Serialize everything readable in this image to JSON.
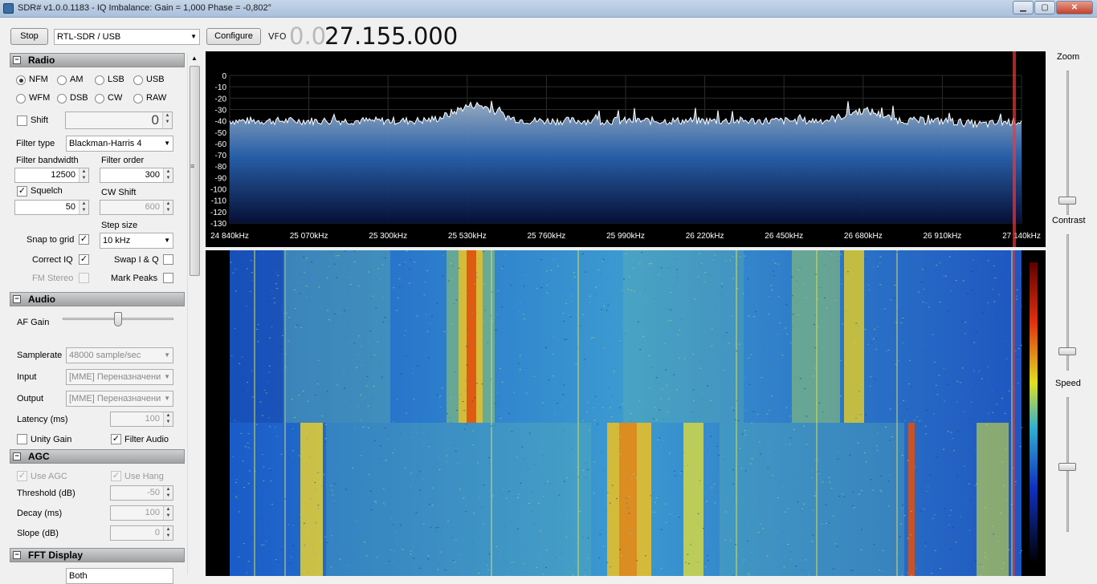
{
  "window": {
    "title": "SDR# v1.0.0.1183 - IQ Imbalance: Gain = 1,000 Phase = -0,802°",
    "min": "▁",
    "max": "▢",
    "close": "✕"
  },
  "toolbar": {
    "stop_label": "Stop",
    "device": "RTL-SDR / USB",
    "configure_label": "Configure",
    "vfo_label": "VFO",
    "vfo_dim": "0.0",
    "vfo_main": "27.155.000"
  },
  "radio": {
    "header": "Radio",
    "modes": [
      {
        "label": "NFM",
        "selected": true
      },
      {
        "label": "AM",
        "selected": false
      },
      {
        "label": "LSB",
        "selected": false
      },
      {
        "label": "USB",
        "selected": false
      },
      {
        "label": "WFM",
        "selected": false
      },
      {
        "label": "DSB",
        "selected": false
      },
      {
        "label": "CW",
        "selected": false
      },
      {
        "label": "RAW",
        "selected": false
      }
    ],
    "shift_label": "Shift",
    "shift_value": "0",
    "filter_type_label": "Filter type",
    "filter_type_value": "Blackman-Harris 4",
    "filter_bandwidth_label": "Filter bandwidth",
    "filter_bandwidth_value": "12500",
    "filter_order_label": "Filter order",
    "filter_order_value": "300",
    "squelch_label": "Squelch",
    "squelch_value": "50",
    "cw_shift_label": "CW Shift",
    "cw_shift_value": "600",
    "step_size_label": "Step size",
    "step_size_value": "10 kHz",
    "snap_label": "Snap to grid",
    "correct_iq_label": "Correct IQ",
    "swap_iq_label": "Swap I & Q",
    "fm_stereo_label": "FM Stereo",
    "mark_peaks_label": "Mark Peaks"
  },
  "audio": {
    "header": "Audio",
    "af_gain_label": "AF Gain",
    "af_gain_level": 0.5,
    "samplerate_label": "Samplerate",
    "samplerate_value": "48000 sample/sec",
    "input_label": "Input",
    "input_value": "[MME] Переназначени",
    "output_label": "Output",
    "output_value": "[MME] Переназначени",
    "latency_label": "Latency (ms)",
    "latency_value": "100",
    "unity_gain_label": "Unity Gain",
    "filter_audio_label": "Filter Audio"
  },
  "agc": {
    "header": "AGC",
    "use_agc_label": "Use AGC",
    "use_hang_label": "Use Hang",
    "threshold_label": "Threshold (dB)",
    "threshold_value": "-50",
    "decay_label": "Decay (ms)",
    "decay_value": "100",
    "slope_label": "Slope (dB)",
    "slope_value": "0"
  },
  "fft": {
    "header": "FFT Display",
    "view_value": "Both"
  },
  "right_panel": {
    "zoom_label": "Zoom",
    "contrast_label": "Contrast",
    "speed_label": "Speed"
  },
  "spectrum": {
    "y_ticks": [
      "0",
      "-10",
      "-20",
      "-30",
      "-40",
      "-50",
      "-60",
      "-70",
      "-80",
      "-90",
      "-100",
      "-110",
      "-120",
      "-130"
    ],
    "x_ticks": [
      "24 840kHz",
      "25 070kHz",
      "25 300kHz",
      "25 530kHz",
      "25 760kHz",
      "25 990kHz",
      "26 220kHz",
      "26 450kHz",
      "26 680kHz",
      "26 910kHz",
      "27 140kHz"
    ],
    "colors": {
      "bg": "#000000",
      "fill_top": "#9fb3c8",
      "fill_bottom": "#06103a",
      "trace": "#ffffff",
      "marker": "#ff3030"
    }
  }
}
